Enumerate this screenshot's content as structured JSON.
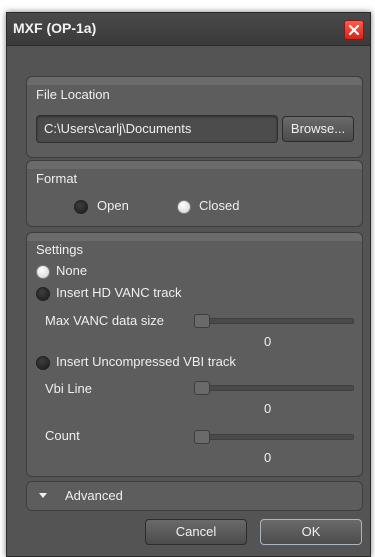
{
  "window": {
    "title": "MXF (OP-1a)"
  },
  "file_location": {
    "label": "File Location",
    "path": "C:\\Users\\carlj\\Documents",
    "browse_label": "Browse..."
  },
  "format": {
    "label": "Format",
    "options": [
      {
        "label": "Open",
        "selected": false
      },
      {
        "label": "Closed",
        "selected": true
      }
    ]
  },
  "settings": {
    "label": "Settings",
    "none_label": "None",
    "hd_vanc_label": "Insert HD VANC track",
    "max_vanc_label": "Max VANC data size",
    "max_vanc_value": "0",
    "vbi_label": "Insert Uncompressed VBI track",
    "vbi_line_label": "Vbi Line",
    "vbi_line_value": "0",
    "count_label": "Count",
    "count_value": "0"
  },
  "advanced": {
    "label": "Advanced"
  },
  "buttons": {
    "cancel": "Cancel",
    "ok": "OK"
  },
  "colors": {
    "close_button": "#e03a2c",
    "panel": "#545454"
  }
}
